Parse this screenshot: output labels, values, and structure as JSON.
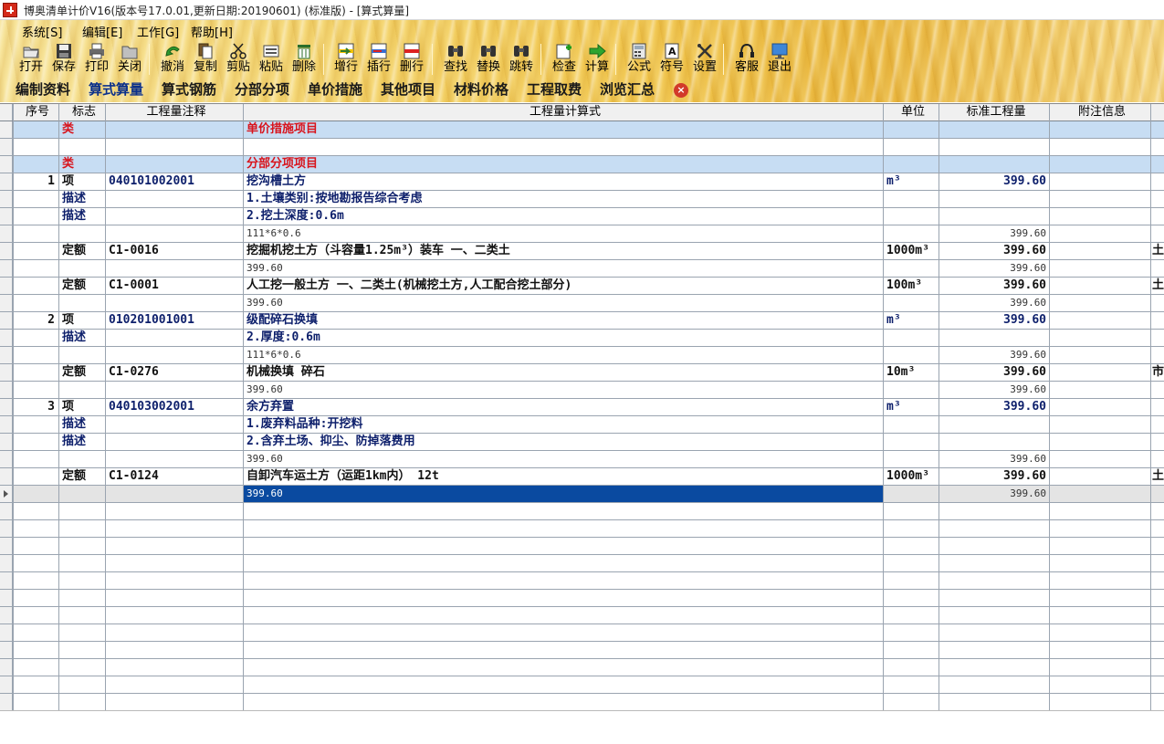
{
  "window": {
    "title": "博奥清单计价V16(版本号17.0.01,更新日期:20190601) (标准版) - [算式算量]"
  },
  "menu": [
    "系统[S]",
    "编辑[E]",
    "工作[G]",
    "帮助[H]"
  ],
  "toolbar": [
    {
      "label": "打开",
      "icon": "folder-open-icon"
    },
    {
      "label": "保存",
      "icon": "floppy-save-icon"
    },
    {
      "label": "打印",
      "icon": "printer-icon"
    },
    {
      "label": "关闭",
      "icon": "folder-close-icon"
    },
    {
      "label": "撤消",
      "icon": "undo-arrow-icon"
    },
    {
      "label": "复制",
      "icon": "copy-icon"
    },
    {
      "label": "剪贴",
      "icon": "scissors-icon"
    },
    {
      "label": "粘贴",
      "icon": "paste-icon"
    },
    {
      "label": "删除",
      "icon": "trash-icon"
    },
    {
      "label": "增行",
      "icon": "insert-row-icon"
    },
    {
      "label": "插行",
      "icon": "insert-line-icon"
    },
    {
      "label": "删行",
      "icon": "delete-row-icon"
    },
    {
      "label": "查找",
      "icon": "binoculars-find-icon"
    },
    {
      "label": "替换",
      "icon": "binoculars-replace-icon"
    },
    {
      "label": "跳转",
      "icon": "binoculars-jump-icon"
    },
    {
      "label": "检查",
      "icon": "check-plus-icon"
    },
    {
      "label": "计算",
      "icon": "green-arrow-calc-icon"
    },
    {
      "label": "公式",
      "icon": "calculator-formula-icon"
    },
    {
      "label": "符号",
      "icon": "symbol-icon"
    },
    {
      "label": "设置",
      "icon": "tools-settings-icon"
    },
    {
      "label": "客服",
      "icon": "headset-icon"
    },
    {
      "label": "退出",
      "icon": "monitor-exit-icon"
    }
  ],
  "tabs": [
    "编制资料",
    "算式算量",
    "算式钢筋",
    "分部分项",
    "单价措施",
    "其他项目",
    "材料价格",
    "工程取费",
    "浏览汇总"
  ],
  "active_tab": 1,
  "grid": {
    "columns": [
      "序号",
      "标志",
      "工程量注释",
      "工程量计算式",
      "单位",
      "标准工程量",
      "附注信息"
    ],
    "rows": [
      {
        "kind": "cat",
        "flag": "类",
        "formula": "单价措施项目"
      },
      {
        "kind": "blank"
      },
      {
        "kind": "cat",
        "flag": "类",
        "formula": "分部分项项目"
      },
      {
        "kind": "item",
        "seq": "1",
        "flag": "项",
        "note": "040101002001",
        "formula": "挖沟槽土方",
        "unit": "m³",
        "qty": "399.60"
      },
      {
        "kind": "desc",
        "flag": "描述",
        "formula": "1.土壤类别:按地勘报告综合考虑"
      },
      {
        "kind": "desc",
        "flag": "描述",
        "formula": "2.挖土深度:0.6m"
      },
      {
        "kind": "calc",
        "formula": "111*6*0.6",
        "qty": "399.60"
      },
      {
        "kind": "quota",
        "flag": "定额",
        "note": "C1-0016",
        "formula": "挖掘机挖土方（斗容量1.25m³）装车 一、二类土",
        "unit": "1000m³",
        "qty": "399.60",
        "extra": "土"
      },
      {
        "kind": "calc",
        "formula": "399.60",
        "qty": "399.60"
      },
      {
        "kind": "quota",
        "flag": "定额",
        "note": "C1-0001",
        "formula": "人工挖一般土方 一、二类土(机械挖土方,人工配合挖土部分)",
        "unit": "100m³",
        "qty": "399.60",
        "extra": "土"
      },
      {
        "kind": "calc",
        "formula": "399.60",
        "qty": "399.60"
      },
      {
        "kind": "item",
        "seq": "2",
        "flag": "项",
        "note": "010201001001",
        "formula": "级配碎石换填",
        "unit": "m³",
        "qty": "399.60"
      },
      {
        "kind": "desc",
        "flag": "描述",
        "formula": "2.厚度:0.6m"
      },
      {
        "kind": "calc",
        "formula": "111*6*0.6",
        "qty": "399.60"
      },
      {
        "kind": "quota",
        "flag": "定额",
        "note": "C1-0276",
        "formula": "机械换填 碎石",
        "unit": "10m³",
        "qty": "399.60",
        "extra": "市"
      },
      {
        "kind": "calc",
        "formula": "399.60",
        "qty": "399.60"
      },
      {
        "kind": "item",
        "seq": "3",
        "flag": "项",
        "note": "040103002001",
        "formula": "余方弃置",
        "unit": "m³",
        "qty": "399.60"
      },
      {
        "kind": "desc",
        "flag": "描述",
        "formula": "1.废弃料品种:开挖料"
      },
      {
        "kind": "desc",
        "flag": "描述",
        "formula": "2.含弃土场、抑尘、防掉落费用"
      },
      {
        "kind": "calc",
        "formula": "399.60",
        "qty": "399.60"
      },
      {
        "kind": "quota",
        "flag": "定额",
        "note": "C1-0124",
        "formula": "自卸汽车运土方（运距1km内） 12t",
        "unit": "1000m³",
        "qty": "399.60",
        "extra": "土"
      },
      {
        "kind": "selected",
        "formula": "399.60",
        "qty": "399.60"
      }
    ]
  }
}
